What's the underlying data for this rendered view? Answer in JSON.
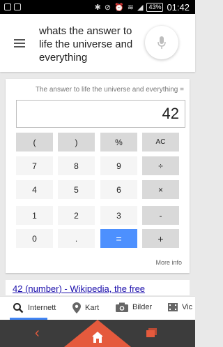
{
  "status_bar": {
    "battery": "43%",
    "time": "01:42"
  },
  "search": {
    "query": "whats the answer to life the universe and everything"
  },
  "calculator": {
    "caption": "The answer to life the universe and everything =",
    "display": "42",
    "keys": [
      [
        "(",
        ")",
        "%",
        "AC"
      ],
      [
        "7",
        "8",
        "9",
        "÷"
      ],
      [
        "4",
        "5",
        "6",
        "×"
      ],
      [
        "1",
        "2",
        "3",
        "-"
      ],
      [
        "0",
        ".",
        "=",
        "+"
      ]
    ],
    "more_info": "More info"
  },
  "result": {
    "title": "42 (number) - Wikipedia, the free"
  },
  "tabs": [
    {
      "label": "Internett",
      "icon": "search-icon"
    },
    {
      "label": "Kart",
      "icon": "map-pin-icon"
    },
    {
      "label": "Bilder",
      "icon": "camera-icon"
    },
    {
      "label": "Vic",
      "icon": "video-icon"
    }
  ],
  "colors": {
    "accent": "#4285f4",
    "equals_key": "#4d90fe",
    "nav_home": "#e55a3d",
    "link": "#1a0dab"
  }
}
